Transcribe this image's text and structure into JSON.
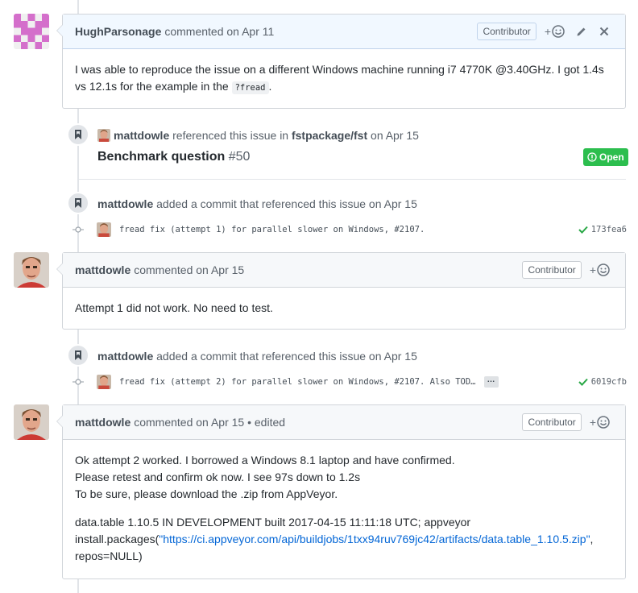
{
  "comments": [
    {
      "author": "HughParsonage",
      "meta": "commented on Apr 11",
      "badge": "Contributor",
      "reaction_plus": "+",
      "body": [
        {
          "text_before": "I was able to reproduce the issue on a different Windows machine running i7 4770K @3.40GHz. I got 1.4s vs 12.1s for the example in the ",
          "code": "?fread",
          "text_after": "."
        }
      ]
    },
    {
      "author": "mattdowle",
      "meta": "commented on Apr 15",
      "badge": "Contributor",
      "reaction_plus": "+",
      "body": [
        "Attempt 1 did not work. No need to test."
      ]
    },
    {
      "author": "mattdowle",
      "meta": "commented on Apr 15 • edited",
      "badge": "Contributor",
      "reaction_plus": "+",
      "body": [
        "Ok attempt 2 worked. I borrowed a Windows 8.1 laptop and have confirmed.",
        "Please retest and confirm ok now. I see 97s down to 1.2s",
        "To be sure, please download the .zip from AppVeyor.",
        "data.table 1.10.5 IN DEVELOPMENT built 2017-04-15 11:11:18 UTC; appveyor",
        "install.packages(",
        "\"https://ci.appveyor.com/api/buildjobs/1txx94ruv769jc42/artifacts/data.table_1.10.5.zip\"",
        ",",
        "repos=NULL)"
      ]
    }
  ],
  "reference_event": {
    "author": "mattdowle",
    "text_middle": "referenced this issue in",
    "repo": "fstpackage/fst",
    "date": "on Apr 15",
    "title": "Benchmark question",
    "number": "#50",
    "state": "Open"
  },
  "commit_events": [
    {
      "author": "mattdowle",
      "text": "added a commit that referenced this issue on Apr 15",
      "commit_message": "fread fix (attempt 1) for parallel slower on Windows, #2107.",
      "sha": "173fea6",
      "has_more": false
    },
    {
      "author": "mattdowle",
      "text": "added a commit that referenced this issue on Apr 15",
      "commit_message": "fread fix (attempt 2) for parallel slower on Windows, #2107. Also TOD…",
      "ellipsis": "…",
      "sha": "6019cfb",
      "has_more": true
    }
  ],
  "colors": {
    "accent_link": "#0366d6",
    "open_state": "#2cbe4e",
    "check": "#28a745",
    "own_header": "#f1f8ff"
  }
}
